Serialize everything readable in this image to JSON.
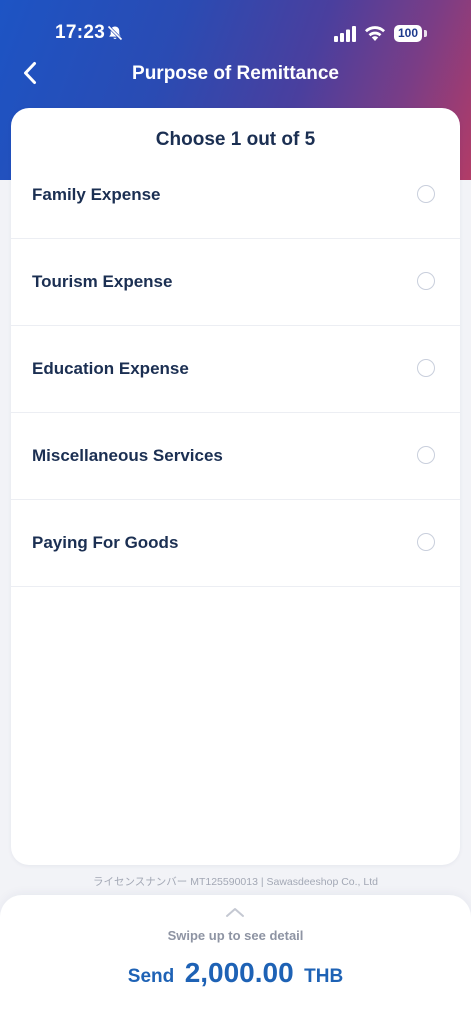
{
  "status_bar": {
    "time": "17:23",
    "battery": "100",
    "icons": [
      "bell-slash-icon",
      "cellular-signal-icon",
      "wifi-icon",
      "battery-icon"
    ]
  },
  "header": {
    "title": "Purpose of Remittance",
    "back_icon": "chevron-left-icon"
  },
  "selection": {
    "heading": "Choose 1 out of 5",
    "options": [
      {
        "label": "Family Expense",
        "selected": false
      },
      {
        "label": "Tourism Expense",
        "selected": false
      },
      {
        "label": "Education Expense",
        "selected": false
      },
      {
        "label": "Miscellaneous Services",
        "selected": false
      },
      {
        "label": "Paying For Goods",
        "selected": false
      }
    ]
  },
  "footer": {
    "license": "ライセンスナンバー MT125590013 | Sawasdeeshop Co., Ltd"
  },
  "bottom_sheet": {
    "hint": "Swipe up to see detail",
    "send_label": "Send",
    "amount": "2,000.00",
    "currency": "THB"
  },
  "colors": {
    "header_gradient_start": "#1d54c4",
    "header_gradient_end": "#b23c67",
    "text_primary": "#1b2f52",
    "amount_accent": "#1e62b5",
    "radio_border": "#c9cfdc"
  }
}
